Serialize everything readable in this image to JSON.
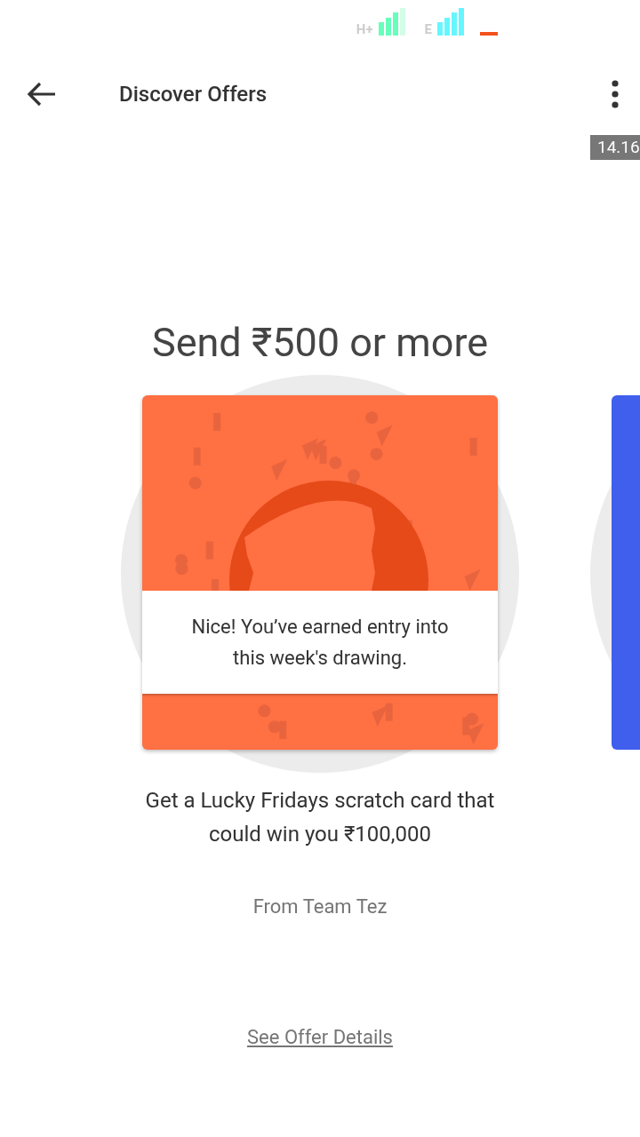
{
  "status_bar": {
    "network_types": [
      "H+",
      "E"
    ]
  },
  "app_bar": {
    "title": "Discover Offers"
  },
  "time_tag": "14.16",
  "offer": {
    "headline": "Send ₹500 or more",
    "card_message": "Nice! You’ve earned entry into this week's drawing.",
    "description": "Get a Lucky Fridays scratch card that could win you ₹100,000",
    "source": "From Team Tez"
  },
  "link": "See Offer Details"
}
